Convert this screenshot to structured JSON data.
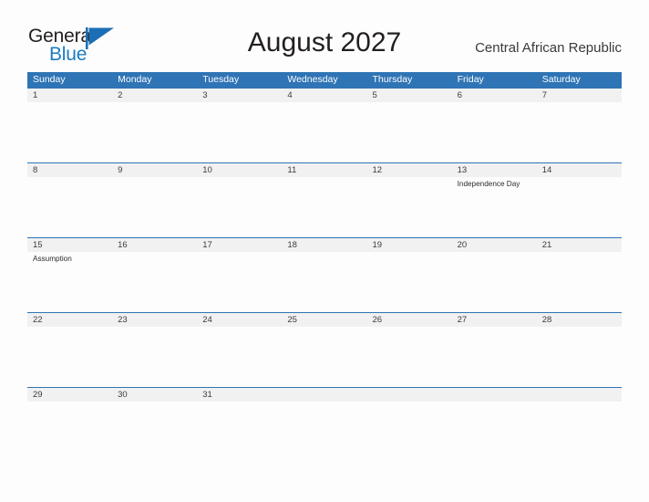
{
  "logo": {
    "word_top": "General",
    "word_bottom": "Blue",
    "flag_icon": "blue-flag-icon",
    "blue": "#1c7cc0",
    "dark": "#231f20"
  },
  "header": {
    "title": "August 2027",
    "country": "Central African Republic"
  },
  "theme": {
    "header_blue": "#2f74b5",
    "date_band": "#f1f1f1",
    "page_background": "#fdfdfd"
  },
  "calendar": {
    "day_headers": [
      "Sunday",
      "Monday",
      "Tuesday",
      "Wednesday",
      "Thursday",
      "Friday",
      "Saturday"
    ],
    "weeks": [
      {
        "dates": [
          "1",
          "2",
          "3",
          "4",
          "5",
          "6",
          "7"
        ],
        "events": [
          [],
          [],
          [],
          [],
          [],
          [],
          []
        ]
      },
      {
        "dates": [
          "8",
          "9",
          "10",
          "11",
          "12",
          "13",
          "14"
        ],
        "events": [
          [],
          [],
          [],
          [],
          [],
          [
            "Independence Day"
          ],
          []
        ]
      },
      {
        "dates": [
          "15",
          "16",
          "17",
          "18",
          "19",
          "20",
          "21"
        ],
        "events": [
          [
            "Assumption"
          ],
          [],
          [],
          [],
          [],
          [],
          []
        ]
      },
      {
        "dates": [
          "22",
          "23",
          "24",
          "25",
          "26",
          "27",
          "28"
        ],
        "events": [
          [],
          [],
          [],
          [],
          [],
          [],
          []
        ]
      },
      {
        "dates": [
          "29",
          "30",
          "31",
          "",
          "",
          "",
          ""
        ],
        "events": [
          [],
          [],
          [],
          [],
          [],
          [],
          []
        ]
      }
    ]
  }
}
